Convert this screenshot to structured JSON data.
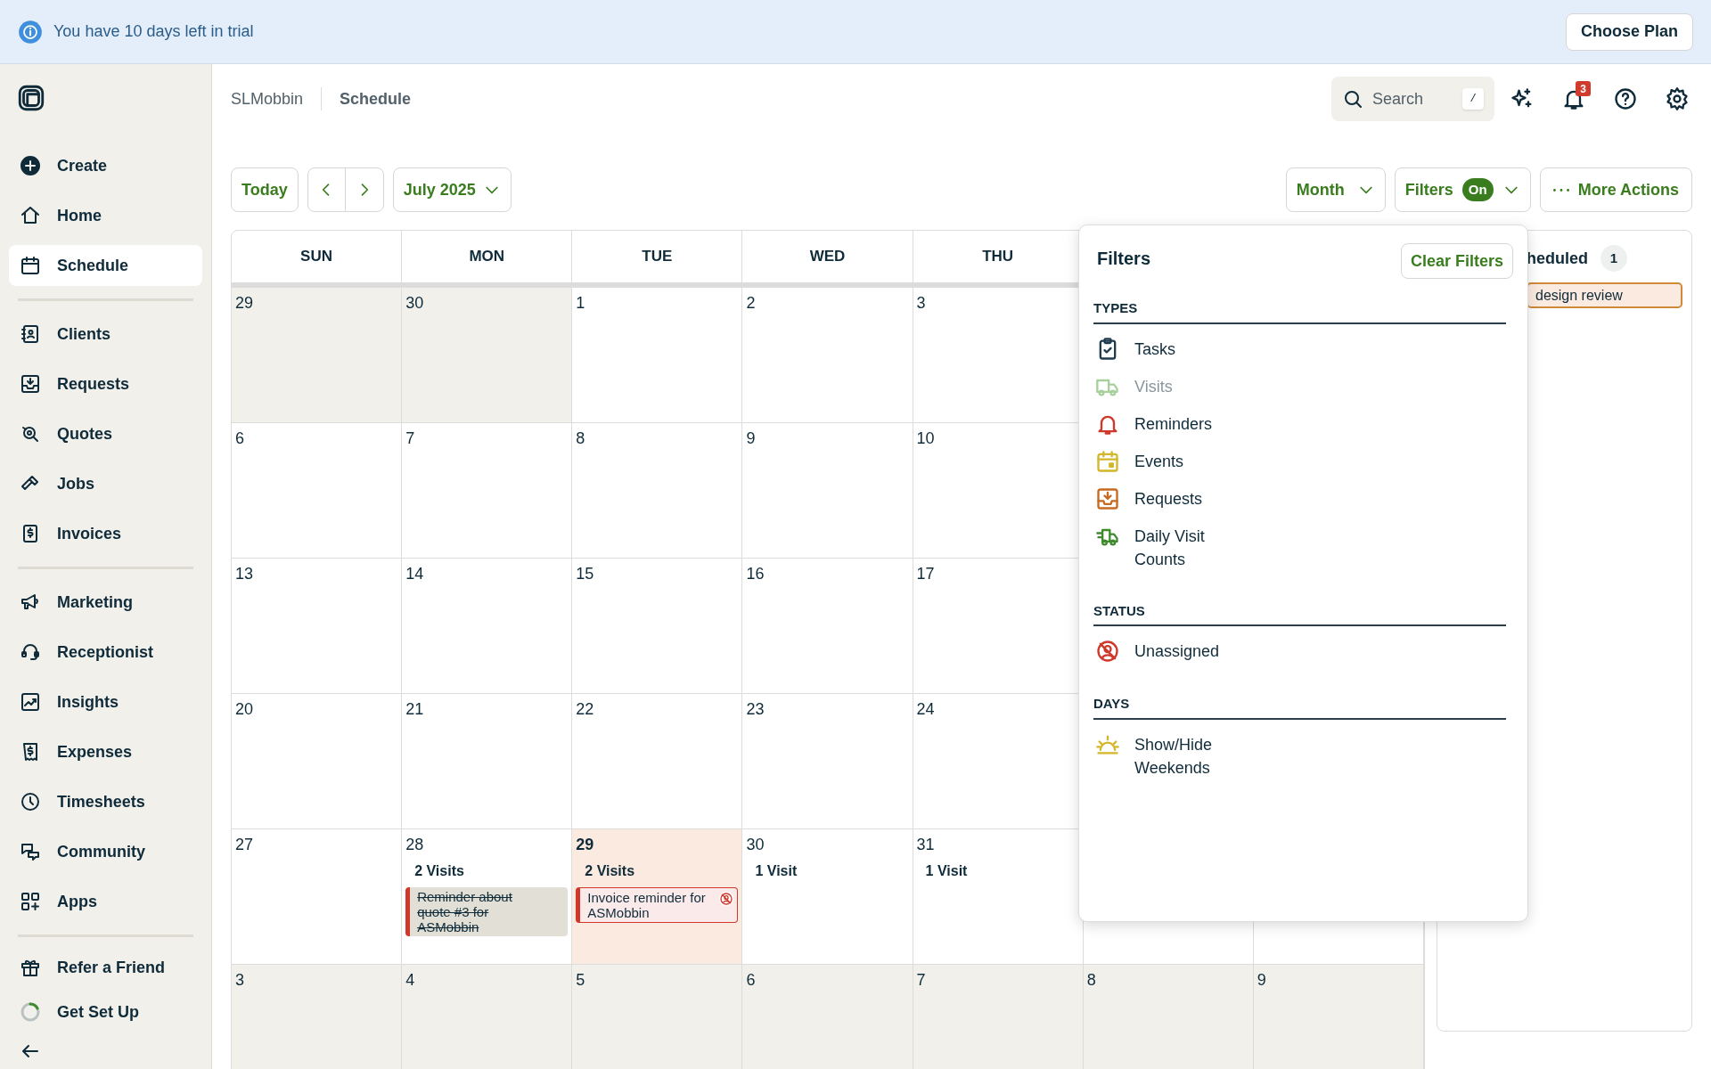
{
  "trial_banner": {
    "message": "You have 10 days left in trial",
    "button": "Choose Plan"
  },
  "sidebar": {
    "groups": [
      [
        {
          "label": "Create",
          "selected": false
        },
        {
          "label": "Home",
          "selected": false
        },
        {
          "label": "Schedule",
          "selected": true
        }
      ],
      [
        {
          "label": "Clients",
          "selected": false
        },
        {
          "label": "Requests",
          "selected": false
        },
        {
          "label": "Quotes",
          "selected": false
        },
        {
          "label": "Jobs",
          "selected": false
        },
        {
          "label": "Invoices",
          "selected": false
        }
      ],
      [
        {
          "label": "Marketing",
          "selected": false
        },
        {
          "label": "Receptionist",
          "selected": false
        },
        {
          "label": "Insights",
          "selected": false
        },
        {
          "label": "Expenses",
          "selected": false
        },
        {
          "label": "Timesheets",
          "selected": false
        },
        {
          "label": "Community",
          "selected": false
        },
        {
          "label": "Apps",
          "selected": false
        }
      ],
      [
        {
          "label": "Refer a Friend",
          "selected": false
        },
        {
          "label": "Get Set Up",
          "selected": false
        }
      ]
    ]
  },
  "breadcrumbs": [
    "SLMobbin",
    "Schedule"
  ],
  "search": {
    "placeholder": "Search",
    "shortcut": "/"
  },
  "notifications": {
    "count": "3"
  },
  "toolbar": {
    "today": "Today",
    "month": "July 2025",
    "view": "Month",
    "filters": "Filters",
    "filters_badge": "On",
    "more": "More Actions"
  },
  "calendar": {
    "columns": [
      "SUN",
      "MON",
      "TUE",
      "WED",
      "THU"
    ],
    "weeks": [
      [
        {
          "date": "29",
          "outside": true,
          "today": false
        },
        {
          "date": "30",
          "outside": true,
          "today": false
        },
        {
          "date": "1",
          "outside": false,
          "today": false
        },
        {
          "date": "2",
          "outside": false,
          "today": false
        },
        {
          "date": "3",
          "outside": false,
          "today": false
        }
      ],
      [
        {
          "date": "6",
          "outside": false,
          "today": false
        },
        {
          "date": "7",
          "outside": false,
          "today": false
        },
        {
          "date": "8",
          "outside": false,
          "today": false
        },
        {
          "date": "9",
          "outside": false,
          "today": false
        },
        {
          "date": "10",
          "outside": false,
          "today": false
        }
      ],
      [
        {
          "date": "13",
          "outside": false,
          "today": false
        },
        {
          "date": "14",
          "outside": false,
          "today": false
        },
        {
          "date": "15",
          "outside": false,
          "today": false
        },
        {
          "date": "16",
          "outside": false,
          "today": false
        },
        {
          "date": "17",
          "outside": false,
          "today": false
        }
      ],
      [
        {
          "date": "20",
          "outside": false,
          "today": false
        },
        {
          "date": "21",
          "outside": false,
          "today": false
        },
        {
          "date": "22",
          "outside": false,
          "today": false
        },
        {
          "date": "23",
          "outside": false,
          "today": false
        },
        {
          "date": "24",
          "outside": false,
          "today": false
        }
      ],
      [
        {
          "date": "27",
          "outside": false,
          "today": false
        },
        {
          "date": "28",
          "outside": false,
          "today": false,
          "visits": "2 Visits",
          "events": [
            {
              "title": "Reminder about quote #3 for ASMobbin",
              "completed": true,
              "unassigned": false
            }
          ]
        },
        {
          "date": "29",
          "outside": false,
          "today": true,
          "visits": "2 Visits",
          "events": [
            {
              "title": "Invoice reminder for ASMobbin",
              "completed": false,
              "unassigned": true
            }
          ]
        },
        {
          "date": "30",
          "outside": false,
          "today": false,
          "visits": "1 Visit"
        },
        {
          "date": "31",
          "outside": false,
          "today": false,
          "visits": "1 Visit"
        }
      ],
      [
        {
          "date": "3",
          "outside": true,
          "today": false
        },
        {
          "date": "4",
          "outside": true,
          "today": false
        },
        {
          "date": "5",
          "outside": true,
          "today": false
        },
        {
          "date": "6",
          "outside": true,
          "today": false
        },
        {
          "date": "7",
          "outside": true,
          "today": false
        },
        {
          "date": "8",
          "outside": true,
          "today": false
        },
        {
          "date": "9",
          "outside": true,
          "today": false
        }
      ]
    ]
  },
  "unscheduled_panel": {
    "title": "heduled",
    "count": "1",
    "items": [
      "design review"
    ]
  },
  "filters_popover": {
    "title": "Filters",
    "clear": "Clear Filters",
    "sections": [
      {
        "heading": "TYPES",
        "items": [
          {
            "label": "Tasks",
            "disabled": false,
            "color": "#1f3b4d"
          },
          {
            "label": "Visits",
            "disabled": true,
            "color": "#a8d09c"
          },
          {
            "label": "Reminders",
            "disabled": false,
            "color": "#d0382b"
          },
          {
            "label": "Events",
            "disabled": false,
            "color": "#d4b62a"
          },
          {
            "label": "Requests",
            "disabled": false,
            "color": "#c8691f"
          },
          {
            "label": "Daily Visit Counts",
            "disabled": false,
            "color": "#3e8b2c"
          }
        ]
      },
      {
        "heading": "STATUS",
        "items": [
          {
            "label": "Unassigned",
            "disabled": false,
            "color": "#d0382b"
          }
        ]
      },
      {
        "heading": "DAYS",
        "items": [
          {
            "label": "Show/Hide Weekends",
            "disabled": false,
            "color": "#d4b62a"
          }
        ]
      }
    ]
  }
}
